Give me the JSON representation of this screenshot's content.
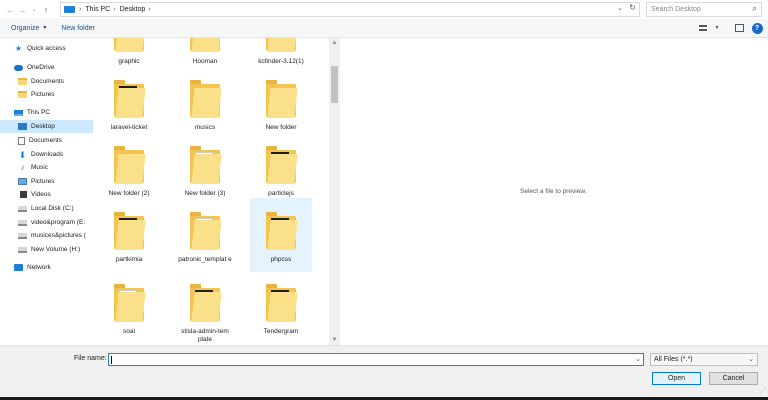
{
  "address": {
    "crumbs": [
      "This PC",
      "Desktop"
    ]
  },
  "search": {
    "placeholder": "Search Desktop"
  },
  "toolbar": {
    "organize": "Organize",
    "new_folder": "New folder"
  },
  "sidebar": {
    "items": [
      {
        "label": "Quick access"
      },
      {
        "label": "OneDrive"
      },
      {
        "label": "Documents"
      },
      {
        "label": "Pictures"
      },
      {
        "label": "This PC"
      },
      {
        "label": "Desktop"
      },
      {
        "label": "Documents"
      },
      {
        "label": "Downloads"
      },
      {
        "label": "Music"
      },
      {
        "label": "Pictures"
      },
      {
        "label": "Videos"
      },
      {
        "label": "Local Disk (C:)"
      },
      {
        "label": "video&program (E:"
      },
      {
        "label": "musices&pictures ("
      },
      {
        "label": "New Volume (H:)"
      },
      {
        "label": "Network"
      }
    ]
  },
  "files": [
    {
      "name": "graphic"
    },
    {
      "name": "Hooman"
    },
    {
      "name": "kcfinder-3.12(1)"
    },
    {
      "name": "laravel-ticket"
    },
    {
      "name": "musics"
    },
    {
      "name": "New folder"
    },
    {
      "name": "New folder (2)"
    },
    {
      "name": "New folder (3)"
    },
    {
      "name": "particlejs"
    },
    {
      "name": "partkimia"
    },
    {
      "name": "patronic_templat e"
    },
    {
      "name": "phpcss"
    },
    {
      "name": "soal"
    },
    {
      "name": "stisla-admin-tem plate"
    },
    {
      "name": "Tendergram"
    }
  ],
  "preview": {
    "message": "Select a file to preview."
  },
  "bottom": {
    "file_name_label": "File name:",
    "file_name_value": "",
    "file_type": "All Files (*.*)",
    "open_label": "Open",
    "cancel_label": "Cancel"
  },
  "colors": {
    "accent": "#0078d7",
    "selection": "#cce8ff",
    "hover": "#e5f3ff",
    "folder": "#f3c450"
  }
}
